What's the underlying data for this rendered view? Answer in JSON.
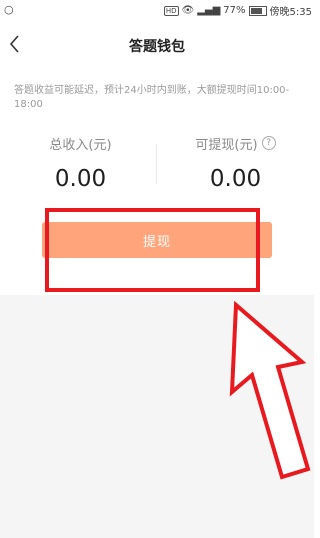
{
  "status_bar": {
    "left_icon": "notification-icon",
    "hd_badge": "HD",
    "battery_percent": "77%",
    "time_text": "傍晚5:35"
  },
  "header": {
    "title": "答题钱包",
    "back_icon": "chevron-left-icon"
  },
  "notice": "答题收益可能延迟，预计24小时内到账，大额提现时间10:00-18:00",
  "balances": {
    "total_income": {
      "label": "总收入(元)",
      "value": "0.00"
    },
    "withdrawable": {
      "label": "可提现(元)",
      "value": "0.00",
      "help_icon": "question-circle-icon",
      "help_glyph": "?"
    }
  },
  "withdraw_button": {
    "label": "提现",
    "color": "#ffa47b"
  },
  "annotation": {
    "highlight_color": "#e8191f",
    "arrow_icon": "arrow-up-left-icon"
  }
}
